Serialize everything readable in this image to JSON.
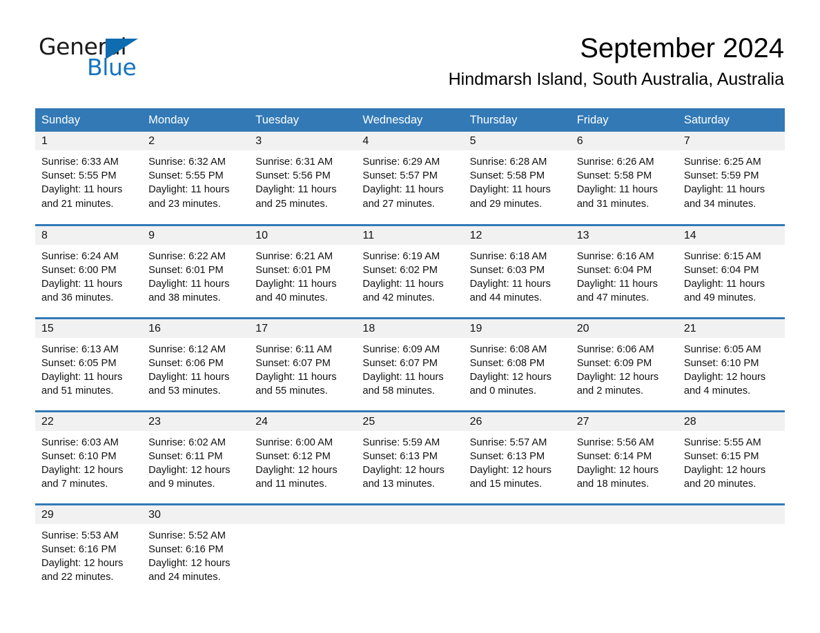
{
  "brand": {
    "logo_text_primary": "General",
    "logo_text_secondary": "Blue",
    "accent_color": "#3279b6",
    "logo_blue": "#1673c0"
  },
  "header": {
    "month_title": "September 2024",
    "location": "Hindmarsh Island, South Australia, Australia"
  },
  "calendar": {
    "weekday_headers": [
      "Sunday",
      "Monday",
      "Tuesday",
      "Wednesday",
      "Thursday",
      "Friday",
      "Saturday"
    ],
    "labels": {
      "sunrise_prefix": "Sunrise:",
      "sunset_prefix": "Sunset:",
      "daylight_prefix": "Daylight:"
    },
    "weeks": [
      [
        {
          "day": "1",
          "sunrise": "Sunrise: 6:33 AM",
          "sunset": "Sunset: 5:55 PM",
          "daylight": "Daylight: 11 hours and 21 minutes."
        },
        {
          "day": "2",
          "sunrise": "Sunrise: 6:32 AM",
          "sunset": "Sunset: 5:55 PM",
          "daylight": "Daylight: 11 hours and 23 minutes."
        },
        {
          "day": "3",
          "sunrise": "Sunrise: 6:31 AM",
          "sunset": "Sunset: 5:56 PM",
          "daylight": "Daylight: 11 hours and 25 minutes."
        },
        {
          "day": "4",
          "sunrise": "Sunrise: 6:29 AM",
          "sunset": "Sunset: 5:57 PM",
          "daylight": "Daylight: 11 hours and 27 minutes."
        },
        {
          "day": "5",
          "sunrise": "Sunrise: 6:28 AM",
          "sunset": "Sunset: 5:58 PM",
          "daylight": "Daylight: 11 hours and 29 minutes."
        },
        {
          "day": "6",
          "sunrise": "Sunrise: 6:26 AM",
          "sunset": "Sunset: 5:58 PM",
          "daylight": "Daylight: 11 hours and 31 minutes."
        },
        {
          "day": "7",
          "sunrise": "Sunrise: 6:25 AM",
          "sunset": "Sunset: 5:59 PM",
          "daylight": "Daylight: 11 hours and 34 minutes."
        }
      ],
      [
        {
          "day": "8",
          "sunrise": "Sunrise: 6:24 AM",
          "sunset": "Sunset: 6:00 PM",
          "daylight": "Daylight: 11 hours and 36 minutes."
        },
        {
          "day": "9",
          "sunrise": "Sunrise: 6:22 AM",
          "sunset": "Sunset: 6:01 PM",
          "daylight": "Daylight: 11 hours and 38 minutes."
        },
        {
          "day": "10",
          "sunrise": "Sunrise: 6:21 AM",
          "sunset": "Sunset: 6:01 PM",
          "daylight": "Daylight: 11 hours and 40 minutes."
        },
        {
          "day": "11",
          "sunrise": "Sunrise: 6:19 AM",
          "sunset": "Sunset: 6:02 PM",
          "daylight": "Daylight: 11 hours and 42 minutes."
        },
        {
          "day": "12",
          "sunrise": "Sunrise: 6:18 AM",
          "sunset": "Sunset: 6:03 PM",
          "daylight": "Daylight: 11 hours and 44 minutes."
        },
        {
          "day": "13",
          "sunrise": "Sunrise: 6:16 AM",
          "sunset": "Sunset: 6:04 PM",
          "daylight": "Daylight: 11 hours and 47 minutes."
        },
        {
          "day": "14",
          "sunrise": "Sunrise: 6:15 AM",
          "sunset": "Sunset: 6:04 PM",
          "daylight": "Daylight: 11 hours and 49 minutes."
        }
      ],
      [
        {
          "day": "15",
          "sunrise": "Sunrise: 6:13 AM",
          "sunset": "Sunset: 6:05 PM",
          "daylight": "Daylight: 11 hours and 51 minutes."
        },
        {
          "day": "16",
          "sunrise": "Sunrise: 6:12 AM",
          "sunset": "Sunset: 6:06 PM",
          "daylight": "Daylight: 11 hours and 53 minutes."
        },
        {
          "day": "17",
          "sunrise": "Sunrise: 6:11 AM",
          "sunset": "Sunset: 6:07 PM",
          "daylight": "Daylight: 11 hours and 55 minutes."
        },
        {
          "day": "18",
          "sunrise": "Sunrise: 6:09 AM",
          "sunset": "Sunset: 6:07 PM",
          "daylight": "Daylight: 11 hours and 58 minutes."
        },
        {
          "day": "19",
          "sunrise": "Sunrise: 6:08 AM",
          "sunset": "Sunset: 6:08 PM",
          "daylight": "Daylight: 12 hours and 0 minutes."
        },
        {
          "day": "20",
          "sunrise": "Sunrise: 6:06 AM",
          "sunset": "Sunset: 6:09 PM",
          "daylight": "Daylight: 12 hours and 2 minutes."
        },
        {
          "day": "21",
          "sunrise": "Sunrise: 6:05 AM",
          "sunset": "Sunset: 6:10 PM",
          "daylight": "Daylight: 12 hours and 4 minutes."
        }
      ],
      [
        {
          "day": "22",
          "sunrise": "Sunrise: 6:03 AM",
          "sunset": "Sunset: 6:10 PM",
          "daylight": "Daylight: 12 hours and 7 minutes."
        },
        {
          "day": "23",
          "sunrise": "Sunrise: 6:02 AM",
          "sunset": "Sunset: 6:11 PM",
          "daylight": "Daylight: 12 hours and 9 minutes."
        },
        {
          "day": "24",
          "sunrise": "Sunrise: 6:00 AM",
          "sunset": "Sunset: 6:12 PM",
          "daylight": "Daylight: 12 hours and 11 minutes."
        },
        {
          "day": "25",
          "sunrise": "Sunrise: 5:59 AM",
          "sunset": "Sunset: 6:13 PM",
          "daylight": "Daylight: 12 hours and 13 minutes."
        },
        {
          "day": "26",
          "sunrise": "Sunrise: 5:57 AM",
          "sunset": "Sunset: 6:13 PM",
          "daylight": "Daylight: 12 hours and 15 minutes."
        },
        {
          "day": "27",
          "sunrise": "Sunrise: 5:56 AM",
          "sunset": "Sunset: 6:14 PM",
          "daylight": "Daylight: 12 hours and 18 minutes."
        },
        {
          "day": "28",
          "sunrise": "Sunrise: 5:55 AM",
          "sunset": "Sunset: 6:15 PM",
          "daylight": "Daylight: 12 hours and 20 minutes."
        }
      ],
      [
        {
          "day": "29",
          "sunrise": "Sunrise: 5:53 AM",
          "sunset": "Sunset: 6:16 PM",
          "daylight": "Daylight: 12 hours and 22 minutes."
        },
        {
          "day": "30",
          "sunrise": "Sunrise: 5:52 AM",
          "sunset": "Sunset: 6:16 PM",
          "daylight": "Daylight: 12 hours and 24 minutes."
        },
        {
          "day": "",
          "sunrise": "",
          "sunset": "",
          "daylight": ""
        },
        {
          "day": "",
          "sunrise": "",
          "sunset": "",
          "daylight": ""
        },
        {
          "day": "",
          "sunrise": "",
          "sunset": "",
          "daylight": ""
        },
        {
          "day": "",
          "sunrise": "",
          "sunset": "",
          "daylight": ""
        },
        {
          "day": "",
          "sunrise": "",
          "sunset": "",
          "daylight": ""
        }
      ]
    ]
  }
}
